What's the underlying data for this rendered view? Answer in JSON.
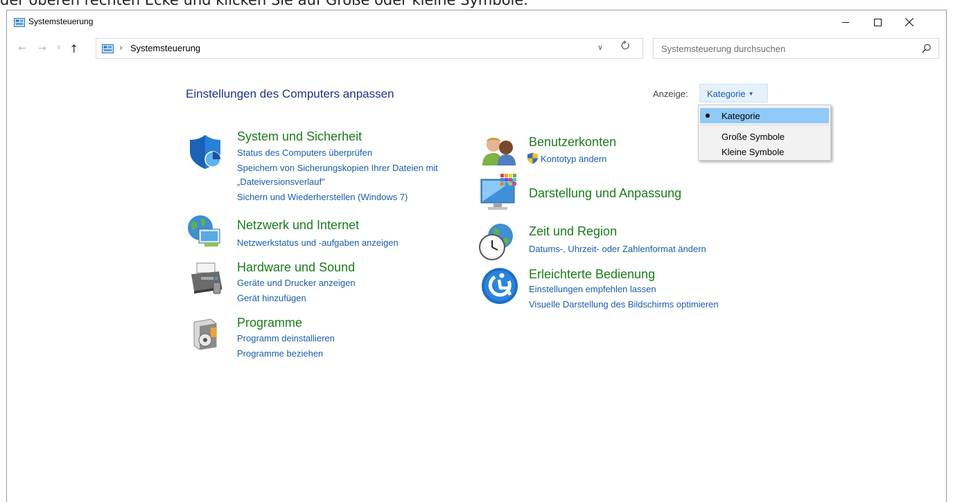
{
  "top_instruction": "der oberen rechten Ecke und klicken Sie auf Große oder kleine Symbole.",
  "window": {
    "title": "Systemsteuerung"
  },
  "address": {
    "crumb": "Systemsteuerung"
  },
  "search": {
    "placeholder": "Systemsteuerung durchsuchen"
  },
  "heading": "Einstellungen des Computers anpassen",
  "view": {
    "label": "Anzeige:",
    "selected": "Kategorie",
    "options": [
      "Kategorie",
      "Große Symbole",
      "Kleine Symbole"
    ]
  },
  "categories": {
    "system": {
      "title": "System und Sicherheit",
      "links": [
        "Status des Computers überprüfen",
        "Speichern von Sicherungskopien Ihrer Dateien mit",
        "„Dateiversionsverlauf\"",
        "Sichern und Wiederherstellen (Windows 7)"
      ]
    },
    "network": {
      "title": "Netzwerk und Internet",
      "links": [
        "Netzwerkstatus und -aufgaben anzeigen"
      ]
    },
    "hardware": {
      "title": "Hardware und Sound",
      "links": [
        "Geräte und Drucker anzeigen",
        "Gerät hinzufügen"
      ]
    },
    "programs": {
      "title": "Programme",
      "links": [
        "Programm deinstallieren",
        "Programme beziehen"
      ]
    },
    "accounts": {
      "title": "Benutzerkonten",
      "links": [
        "Kontotyp ändern"
      ]
    },
    "appearance": {
      "title": "Darstellung und Anpassung",
      "links": []
    },
    "clock": {
      "title": "Zeit und Region",
      "links": [
        "Datums-, Uhrzeit- oder Zahlenformat ändern"
      ]
    },
    "ease": {
      "title": "Erleichterte Bedienung",
      "links": [
        "Einstellungen empfehlen lassen",
        "Visuelle Darstellung des Bildschirms optimieren"
      ]
    }
  },
  "icons": [
    "window-icon",
    "back-arrow-icon",
    "forward-arrow-icon",
    "recent-dropdown-icon",
    "up-arrow-icon",
    "refresh-icon",
    "search-icon",
    "shield-icon",
    "network-icon",
    "printer-icon",
    "programs-icon",
    "users-icon",
    "uac-shield-icon",
    "display-icon",
    "clock-globe-icon",
    "accessibility-icon"
  ],
  "colors": {
    "category_title": "#1a7c1a",
    "link": "#1a5cad",
    "heading": "#1e3287",
    "menu_selected": "#91c9f7"
  }
}
